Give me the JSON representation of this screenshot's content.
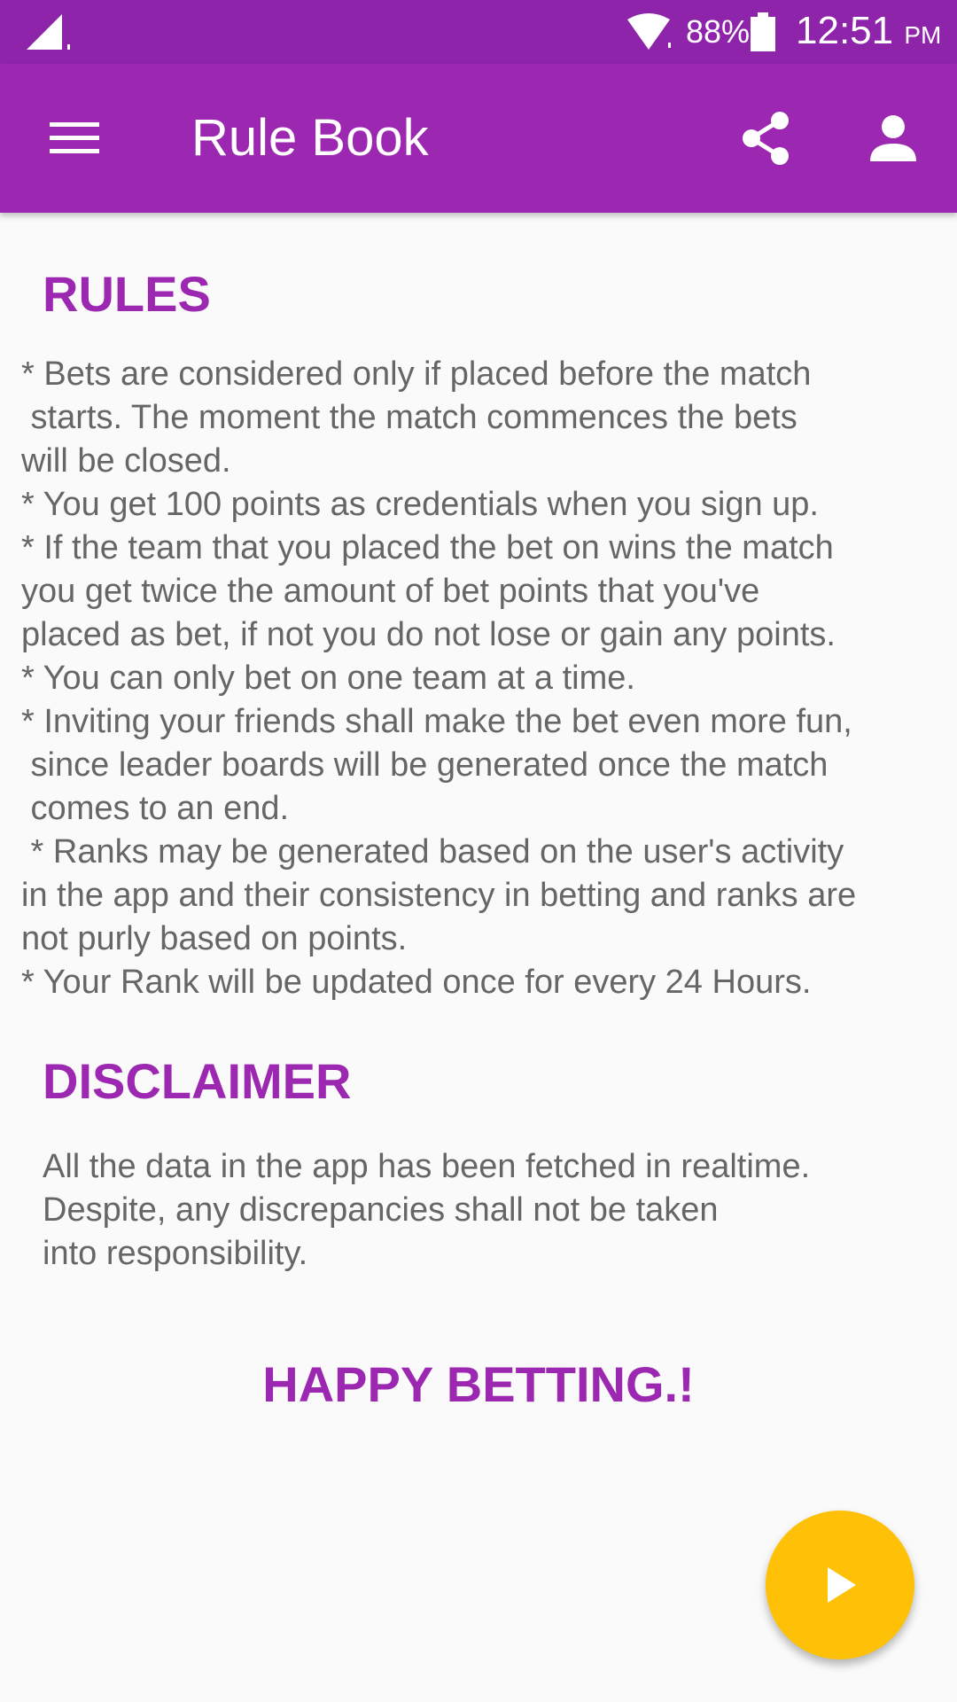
{
  "status_bar": {
    "battery_percent": "88%",
    "time": "12:51",
    "ampm": "PM",
    "icons": [
      "signal-icon",
      "wifi-icon",
      "battery-icon"
    ]
  },
  "app_bar": {
    "title": "Rule Book",
    "icons": [
      "menu-icon",
      "share-icon",
      "account-icon"
    ]
  },
  "rules": {
    "heading": "RULES",
    "lines": [
      "* Bets are considered only if placed before the match",
      " starts. The moment the match commences the bets",
      "will be closed.",
      "* You get 100 points as credentials when you sign up.",
      "* If the team that you placed the bet on wins the match",
      "you get twice the amount of bet points that you've",
      "placed as bet, if not you do not lose or gain any points.",
      "* You can only bet on one team at a time.",
      "* Inviting your friends shall make the bet even more fun,",
      " since leader boards will be generated once the match",
      " comes to an end.",
      " * Ranks may be generated based on the user's activity",
      "in the app and their consistency in betting and ranks are",
      "not purly based on points.",
      "* Your Rank will be updated once for every 24 Hours."
    ]
  },
  "disclaimer": {
    "heading": "DISCLAIMER",
    "lines": [
      "All the data in the app has been fetched in realtime.",
      "Despite, any discrepancies shall not be taken",
      "into responsibility."
    ]
  },
  "closing": "HAPPY BETTING.!",
  "fab": {
    "icon": "play-icon"
  },
  "colors": {
    "status_bar": "#8e24aa",
    "app_bar": "#9c27b0",
    "accent_heading": "#9c27b0",
    "body_text": "#666666",
    "fab": "#ffc107",
    "background": "#fafafa"
  }
}
